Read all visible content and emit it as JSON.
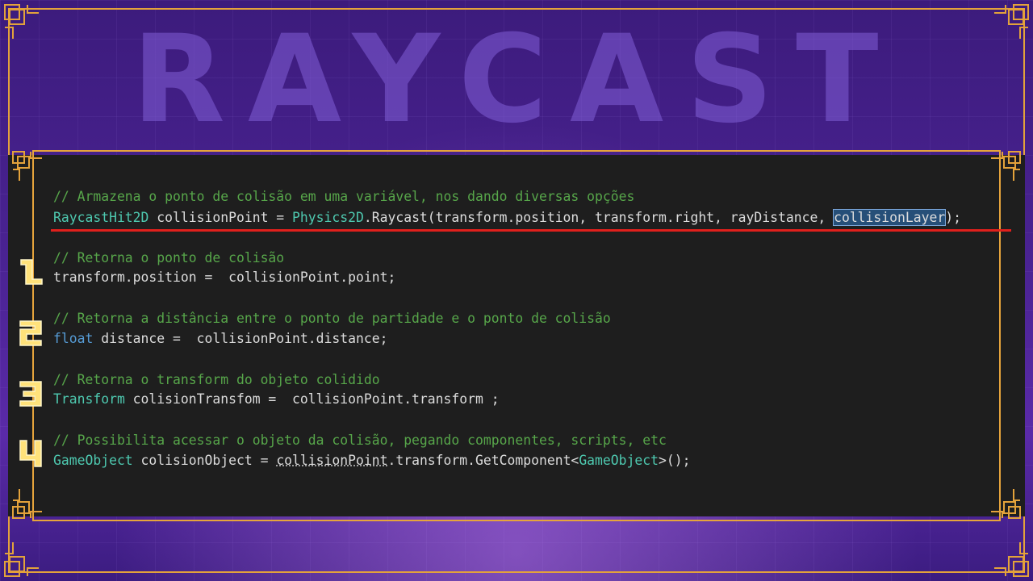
{
  "background": {
    "title": "RAYCAST",
    "colors": {
      "bg": "#4a2393",
      "frame": "#e3a23b",
      "title": "#825fd7"
    }
  },
  "code": {
    "block1": {
      "comment": "// Armazena o ponto de colisão em uma variável, nos dando diversas opções",
      "tokens": {
        "type": "RaycastHit2D",
        "var": " collisionPoint = ",
        "physics": "Physics2D",
        "call": ".Raycast(transform.position, transform.right, rayDistance, ",
        "selected": "collisionLayer",
        "end": ");"
      }
    },
    "items": [
      {
        "number": "1",
        "comment": "// Retorna o ponto de colisão",
        "code": "transform.position =  collisionPoint.point;"
      },
      {
        "number": "2",
        "comment": "// Retorna a distância entre o ponto de partidade e o ponto de colisão",
        "kw": "float",
        "code": " distance =  collisionPoint.distance;"
      },
      {
        "number": "3",
        "comment": "// Retorna o transform do objeto colidido",
        "type": "Transform",
        "code": " colisionTransfom =  collisionPoint.transform ;"
      },
      {
        "number": "4",
        "comment": "// Possibilita acessar o objeto da colisão, pegando componentes, scripts, etc",
        "type": "GameObject",
        "code_a": " colisionObject = ",
        "code_b": "collisionPoint",
        "code_c": ".transform.GetComponent<",
        "type2": "GameObject",
        "code_d": ">();"
      }
    ],
    "colors": {
      "panel": "#1e1e1e",
      "comment": "#57a64a",
      "type": "#4ec9b0",
      "keyword": "#569cd6",
      "underline": "#e0201c",
      "number": "#ffe27a"
    }
  }
}
